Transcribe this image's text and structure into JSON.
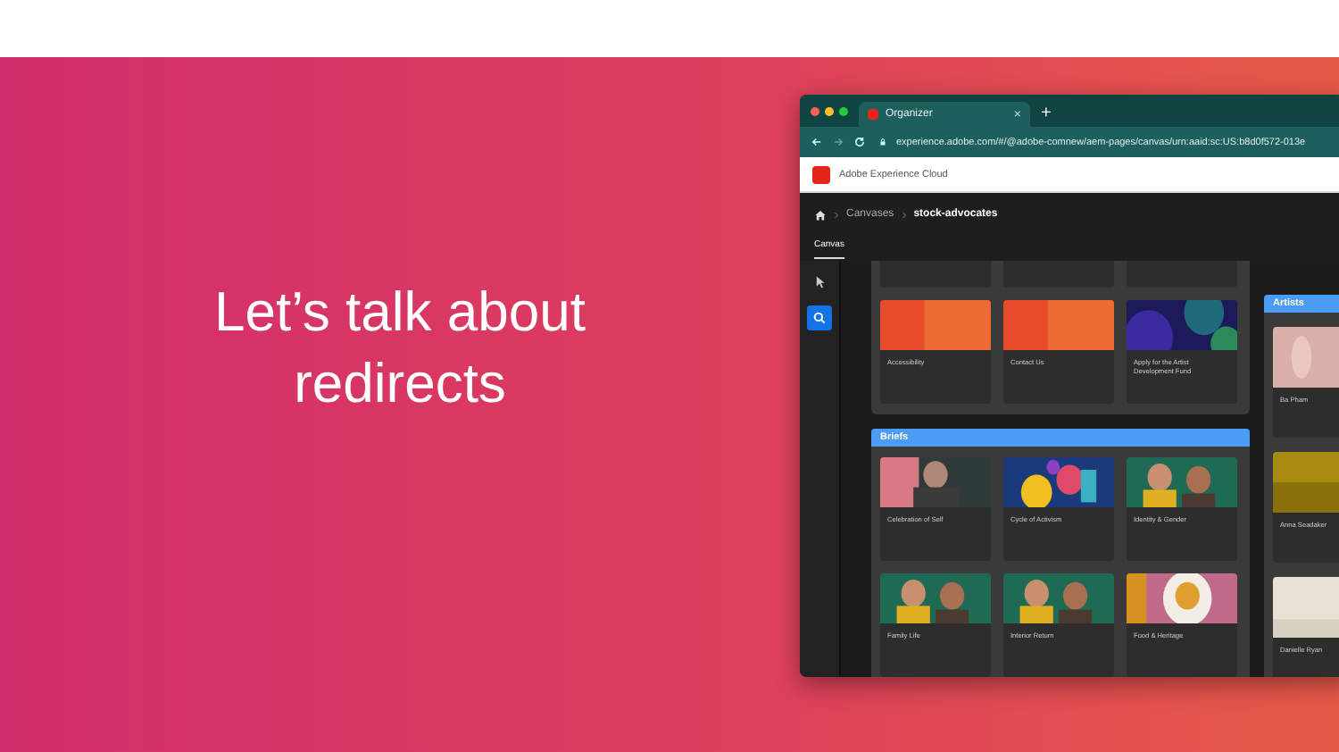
{
  "slide": {
    "heading": "Let’s talk about redirects"
  },
  "browser": {
    "tab": {
      "title": "Organizer",
      "close": "×"
    },
    "new_tab": "+",
    "url": "experience.adobe.com/#/@adobe-comnew/aem-pages/canvas/urn:aaid:sc:US:b8d0f572-013e",
    "app_header": {
      "title": "Adobe Experience Cloud"
    },
    "breadcrumb": [
      {
        "label": "Canvases",
        "current": false
      },
      {
        "label": "stock-advocates",
        "current": true
      }
    ],
    "tabs": [
      {
        "label": "Canvas",
        "selected": true
      }
    ],
    "rail": [
      {
        "kind": "pointer",
        "selected": false
      },
      {
        "kind": "search",
        "selected": true
      }
    ],
    "canvas_group": {
      "cards": [
        {
          "title": "Accessibility"
        },
        {
          "title": "Contact Us"
        },
        {
          "title": "Apply for the Artist Development Fund"
        }
      ]
    },
    "briefs": {
      "title": "Briefs",
      "cards": [
        {
          "title": "Celebration of Self"
        },
        {
          "title": "Cycle of Activism"
        },
        {
          "title": "Identity & Gender"
        },
        {
          "title": "Family Life"
        },
        {
          "title": "Interior Return"
        },
        {
          "title": "Food & Heritage"
        }
      ]
    },
    "artists": {
      "title": "Artists",
      "cards": [
        {
          "title": "Ba Pham"
        },
        {
          "title": "Anna Seadaker"
        },
        {
          "title": "Danielle Ryan"
        }
      ]
    }
  }
}
